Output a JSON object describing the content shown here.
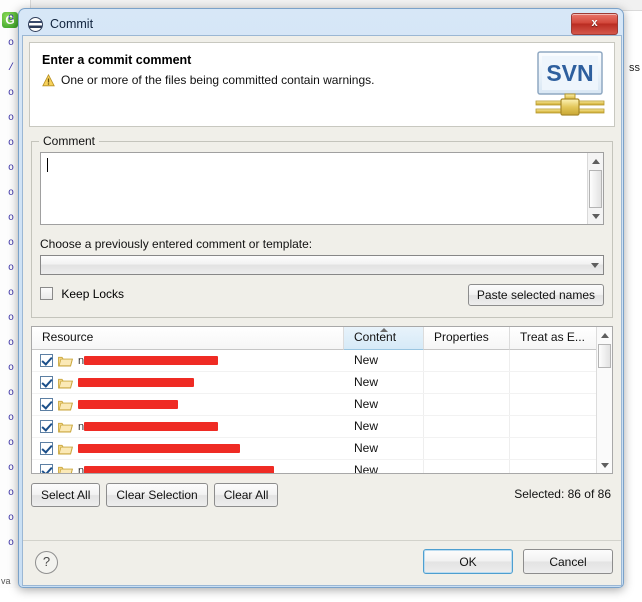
{
  "window": {
    "title": "Commit",
    "icon": "svn-commit-icon",
    "close_label": "x"
  },
  "header": {
    "title": "Enter a commit comment",
    "message": "One or more of the files being committed contain warnings.",
    "warning_icon": "warning-triangle-icon",
    "logo_text": "SVN",
    "logo_name": "svn-logo"
  },
  "comment": {
    "legend": "Comment",
    "value": "",
    "placeholder": ""
  },
  "template_chooser": {
    "label": "Choose a previously entered comment or template:",
    "selected": "",
    "options": []
  },
  "keep_locks": {
    "label": "Keep Locks",
    "checked": false
  },
  "paste_button": {
    "label": "Paste selected names"
  },
  "table": {
    "columns": [
      "Resource",
      "Content",
      "Properties",
      "Treat as E..."
    ],
    "sorted_column": "Content",
    "sort_direction": "asc",
    "rows": [
      {
        "checked": true,
        "icon": "folder-icon",
        "name_prefix": "n",
        "redacted_width": 134,
        "content": "New",
        "properties": "",
        "treat_as": ""
      },
      {
        "checked": true,
        "icon": "folder-icon",
        "name_prefix": "",
        "redacted_width": 116,
        "content": "New",
        "properties": "",
        "treat_as": ""
      },
      {
        "checked": true,
        "icon": "folder-icon",
        "name_prefix": "",
        "redacted_width": 100,
        "content": "New",
        "properties": "",
        "treat_as": ""
      },
      {
        "checked": true,
        "icon": "folder-icon",
        "name_prefix": "n",
        "redacted_width": 134,
        "content": "New",
        "properties": "",
        "treat_as": ""
      },
      {
        "checked": true,
        "icon": "folder-icon",
        "name_prefix": "",
        "redacted_width": 162,
        "content": "New",
        "properties": "",
        "treat_as": ""
      },
      {
        "checked": true,
        "icon": "folder-icon",
        "name_prefix": "n",
        "redacted_width": 190,
        "content": "New",
        "properties": "",
        "treat_as": ""
      }
    ]
  },
  "selection_buttons": {
    "select_all": "Select All",
    "clear_selection": "Clear Selection",
    "clear_all": "Clear All"
  },
  "status": {
    "selected_text": "Selected: 86 of 86"
  },
  "footer": {
    "help_label": "?",
    "ok_label": "OK",
    "cancel_label": "Cancel"
  },
  "background": {
    "right_fragment": "ss",
    "badge_letter": "G",
    "left_fragment": "va",
    "gutter_marks": [
      "o",
      "o",
      "/",
      "o",
      "o",
      "o",
      "o",
      "o",
      "o",
      "o",
      "o",
      "o",
      "o",
      "o",
      "o",
      "o",
      "o",
      "o",
      "o",
      "o",
      "o",
      "o"
    ],
    "bottom_status": ""
  },
  "colors": {
    "accent": "#4e9fd0",
    "redaction": "#ef2b24",
    "title_bar": "#cfe2f5",
    "close_button": "#ba2c22",
    "folder": "#f5cf6b"
  }
}
